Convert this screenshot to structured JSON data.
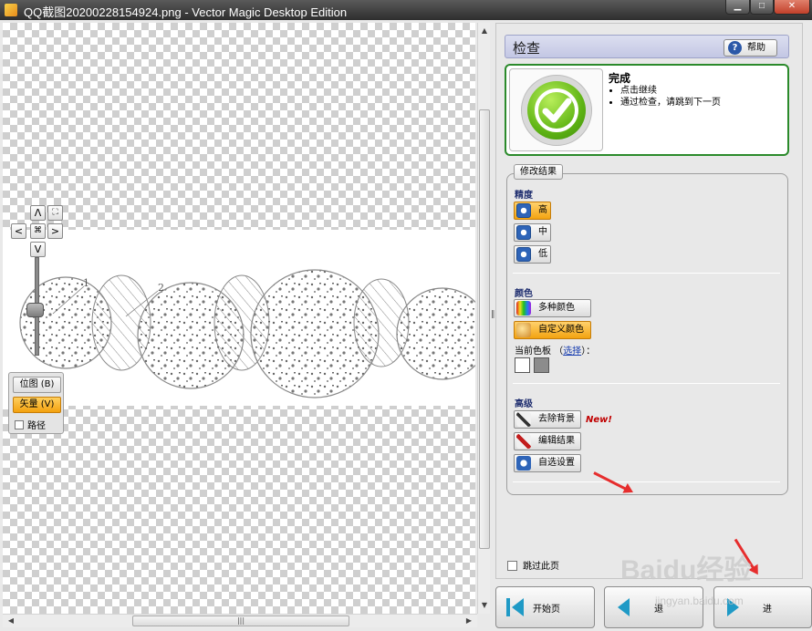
{
  "window": {
    "title": "QQ截图20200228154924.png - Vector Magic Desktop Edition",
    "min_glyph": "▁",
    "max_glyph": "□",
    "close_glyph": "✕"
  },
  "canvas": {
    "nav": {
      "up": "Λ",
      "down": "V",
      "left": "<",
      "right": ">",
      "center": "⌘",
      "fit": "⛶"
    },
    "callouts": [
      "1",
      "2"
    ],
    "view_modes": [
      {
        "label": "位图 (B)",
        "active": false
      },
      {
        "label": "矢量 (V)",
        "active": true
      }
    ],
    "path_checkbox_label": "路径"
  },
  "panel": {
    "title": "检查",
    "help_label": "帮助",
    "status": {
      "title": "完成",
      "bullets": [
        "点击继续",
        "通过检查，请跳到下一页"
      ]
    },
    "group_label": "修改结果",
    "precision": {
      "heading": "精度",
      "options": [
        {
          "label": "高",
          "selected": true
        },
        {
          "label": "中",
          "selected": false
        },
        {
          "label": "低",
          "selected": false
        }
      ]
    },
    "color": {
      "heading": "颜色",
      "options": [
        {
          "label": "多种颜色",
          "selected": false
        },
        {
          "label": "自定义颜色",
          "selected": true
        }
      ],
      "palette_prefix": "当前色板",
      "palette_link": "选择",
      "palette_suffix": "：",
      "swatches": [
        "#ffffff",
        "#8c8c8c"
      ]
    },
    "advanced": {
      "heading": "高级",
      "buttons": [
        "去除背景",
        "编辑结果",
        "自选设置"
      ],
      "new_badge": "New!"
    },
    "skip_label": "跳过此页"
  },
  "footer": {
    "start_label": "开始页",
    "back_label": "退",
    "next_label": "进"
  },
  "watermark": {
    "text": "Baidu经验",
    "url": "jingyan.baidu.com"
  },
  "colors": {
    "accent_orange": "#f3a310",
    "success_green": "#2b8a2b",
    "annotation_red": "#e62d2d"
  }
}
